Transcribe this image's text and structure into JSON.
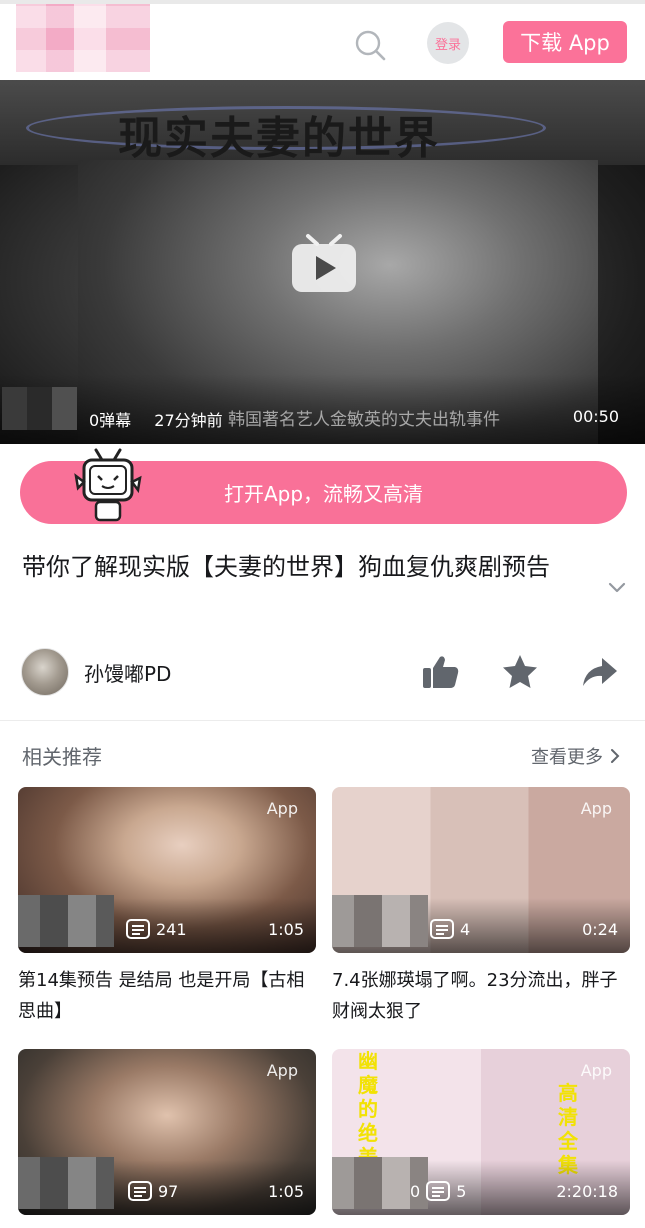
{
  "header": {
    "login_label": "登录",
    "download_label": "下载 App"
  },
  "player": {
    "poster_title": "现实夫妻的世界",
    "danmaku_count": "0弹幕",
    "time_ago": "27分钟前",
    "subtitle": "韩国著名艺人金敏英的丈夫出轨事件",
    "duration": "00:50"
  },
  "open_app_label": "打开App，流畅又高清",
  "video": {
    "title": "带你了解现实版【夫妻的世界】狗血复仇爽剧预告",
    "author": "孙馒嘟PD"
  },
  "recommend": {
    "heading": "相关推荐",
    "more_label": "查看更多",
    "items": [
      {
        "badge": "App",
        "count": "241",
        "duration": "1:05",
        "title": "第14集预告 是结局 也是开局【古相思曲】"
      },
      {
        "badge": "App",
        "count": "4",
        "duration": "0:24",
        "title": "7.4张娜瑛塌了啊。23分流出，胖子财阀太狠了"
      },
      {
        "badge": "App",
        "count": "97",
        "duration": "1:05",
        "title": ""
      },
      {
        "badge": "App",
        "count": "5",
        "duration": "2:20:18",
        "title": "",
        "prefix": "0",
        "overlay_left": "幽魔的绝美女",
        "overlay_right": "高清全集"
      }
    ]
  },
  "colors": {
    "accent": "#fb7299",
    "text": "#18191c",
    "muted": "#61666d"
  }
}
